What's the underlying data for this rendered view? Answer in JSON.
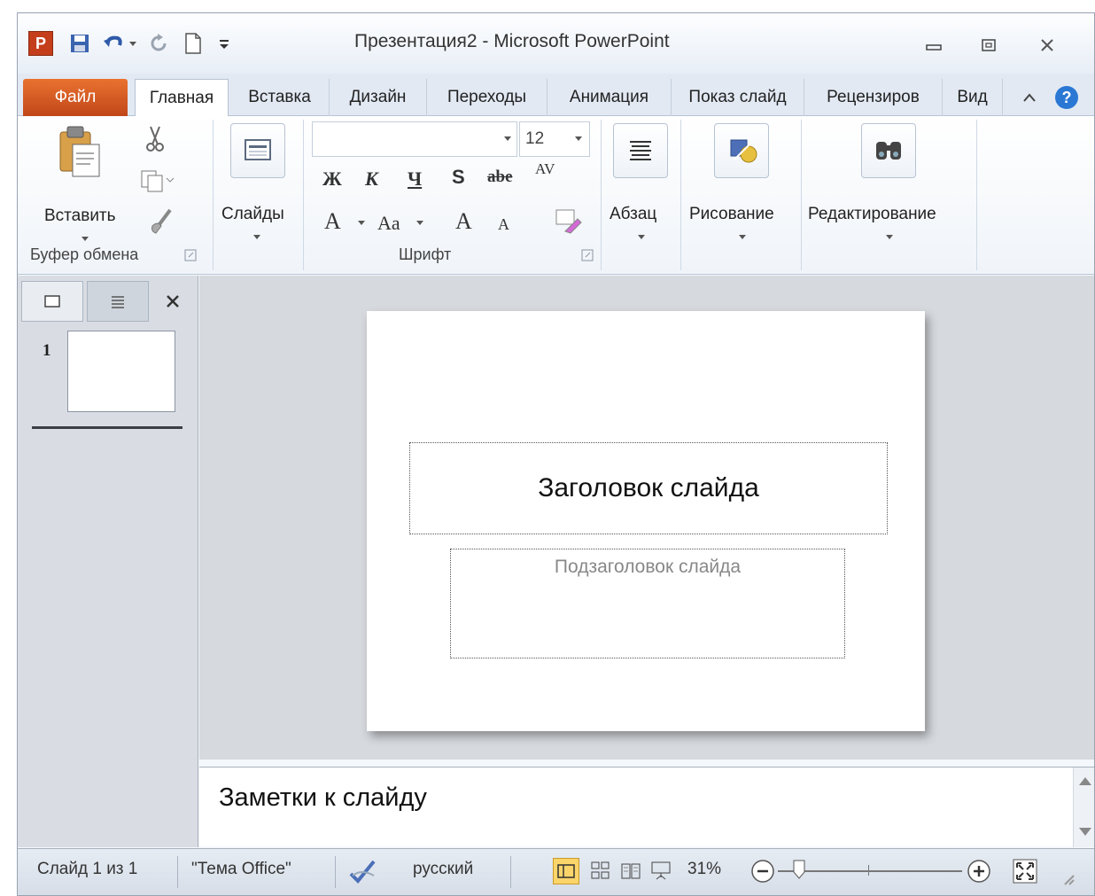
{
  "window": {
    "title": "Презентация2 - Microsoft PowerPoint",
    "app_icon_letter": "P"
  },
  "tabs": [
    {
      "label": "Файл"
    },
    {
      "label": "Главная"
    },
    {
      "label": "Вставка"
    },
    {
      "label": "Дизайн"
    },
    {
      "label": "Переходы"
    },
    {
      "label": "Анимация"
    },
    {
      "label": "Показ слайд"
    },
    {
      "label": "Рецензиров"
    },
    {
      "label": "Вид"
    }
  ],
  "ribbon": {
    "clipboard": {
      "paste_label": "Вставить",
      "group_label": "Буфер обмена"
    },
    "slides": {
      "label": "Слайды"
    },
    "font": {
      "font_name": "",
      "font_size": "12",
      "group_label": "Шрифт",
      "bold": "Ж",
      "italic": "К",
      "underline": "Ч",
      "shadow": "S",
      "strike": "abe",
      "spacing": "AV",
      "color": "A",
      "case": "Aa",
      "grow": "A",
      "shrink": "A"
    },
    "paragraph": {
      "label": "Абзац"
    },
    "drawing": {
      "label": "Рисование"
    },
    "editing": {
      "label": "Редактирование"
    }
  },
  "slide_panel": {
    "slide_number": "1"
  },
  "slide": {
    "title_placeholder": "Заголовок слайда",
    "subtitle_placeholder": "Подзаголовок слайда"
  },
  "notes": {
    "placeholder": "Заметки к слайду"
  },
  "statusbar": {
    "slide_info": "Слайд 1 из 1",
    "theme": "\"Тема Office\"",
    "language": "русский",
    "zoom": "31%",
    "zoom_level": 0.31
  },
  "colors": {
    "file_tab": "#d9571f",
    "accent": "#2b5797"
  }
}
